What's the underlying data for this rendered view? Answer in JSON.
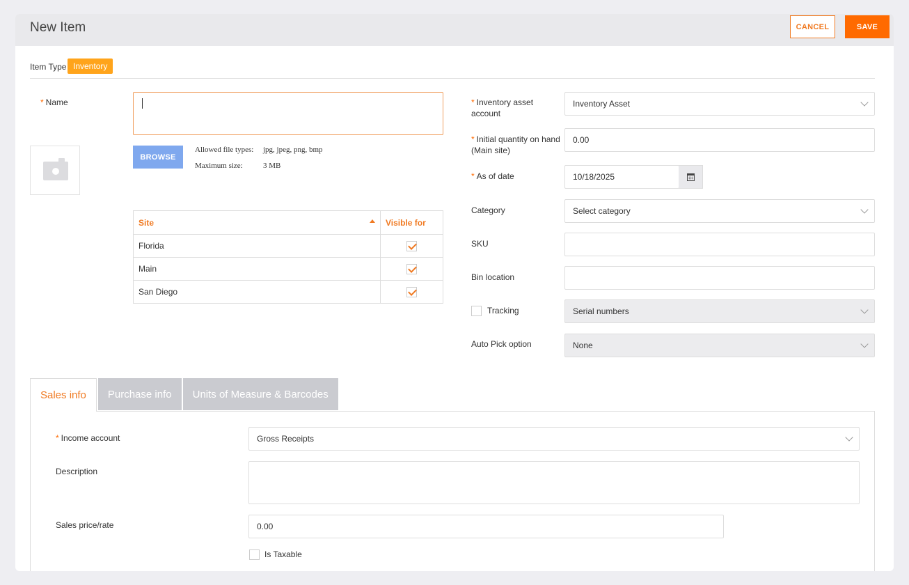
{
  "header": {
    "title": "New Item",
    "cancel_label": "CANCEL",
    "save_label": "SAVE"
  },
  "item_type": {
    "label": "Item Type",
    "value": "Inventory"
  },
  "left": {
    "name_label": "Name",
    "name_value": "",
    "browse_label": "BROWSE",
    "allowed_types_label": "Allowed file types:",
    "allowed_types_value": "jpg, jpeg, png, bmp",
    "max_size_label": "Maximum size:",
    "max_size_value": "3 MB",
    "site_table": {
      "headers": [
        "Site",
        "Visible for"
      ],
      "rows": [
        {
          "site": "Florida",
          "visible": true
        },
        {
          "site": "Main",
          "visible": true
        },
        {
          "site": "San Diego",
          "visible": true
        }
      ]
    }
  },
  "right": {
    "inventory_asset_account": {
      "label": "Inventory asset account",
      "value": "Inventory Asset"
    },
    "initial_quantity": {
      "label": "Initial quantity on hand (Main site)",
      "value": "0.00"
    },
    "as_of_date": {
      "label": "As of date",
      "value": "10/18/2025"
    },
    "category": {
      "label": "Category",
      "value": "Select category"
    },
    "sku": {
      "label": "SKU",
      "value": ""
    },
    "bin_location": {
      "label": "Bin location",
      "value": ""
    },
    "tracking": {
      "label": "Tracking",
      "value": "Serial numbers",
      "checked": false
    },
    "auto_pick": {
      "label": "Auto Pick option",
      "value": "None"
    }
  },
  "tabs": [
    {
      "label": "Sales info",
      "active": true
    },
    {
      "label": "Purchase info",
      "active": false
    },
    {
      "label": "Units of Measure & Barcodes",
      "active": false
    }
  ],
  "sales": {
    "income_account": {
      "label": "Income account",
      "value": "Gross Receipts"
    },
    "description": {
      "label": "Description",
      "value": ""
    },
    "sales_price": {
      "label": "Sales price/rate",
      "value": "0.00"
    },
    "is_taxable": {
      "label": "Is Taxable",
      "checked": false
    }
  },
  "colors": {
    "accent": "#ff6a00",
    "badge": "#ffa41b",
    "browse": "#7fa8ee"
  }
}
